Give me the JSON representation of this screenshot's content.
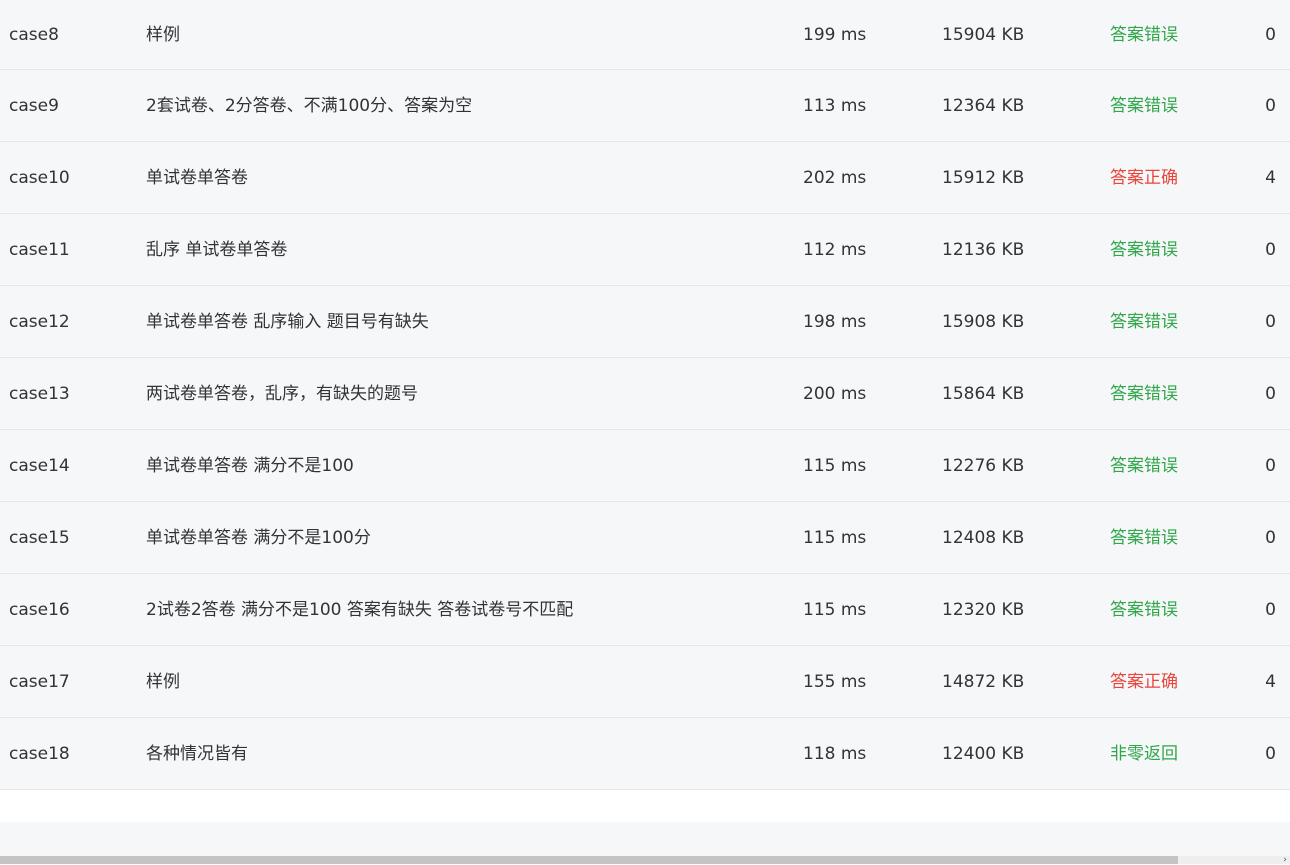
{
  "rows": [
    {
      "name": "case8",
      "desc": "样例",
      "time": "199 ms",
      "memory": "15904 KB",
      "status": "答案错误",
      "status_kind": "wrong",
      "score": "0"
    },
    {
      "name": "case9",
      "desc": "2套试卷、2分答卷、不满100分、答案为空",
      "time": "113 ms",
      "memory": "12364 KB",
      "status": "答案错误",
      "status_kind": "wrong",
      "score": "0"
    },
    {
      "name": "case10",
      "desc": "单试卷单答卷",
      "time": "202 ms",
      "memory": "15912 KB",
      "status": "答案正确",
      "status_kind": "right",
      "score": "4"
    },
    {
      "name": "case11",
      "desc": "乱序 单试卷单答卷",
      "time": "112 ms",
      "memory": "12136 KB",
      "status": "答案错误",
      "status_kind": "wrong",
      "score": "0"
    },
    {
      "name": "case12",
      "desc": "单试卷单答卷 乱序输入 题目号有缺失",
      "time": "198 ms",
      "memory": "15908 KB",
      "status": "答案错误",
      "status_kind": "wrong",
      "score": "0"
    },
    {
      "name": "case13",
      "desc": "两试卷单答卷，乱序，有缺失的题号",
      "time": "200 ms",
      "memory": "15864 KB",
      "status": "答案错误",
      "status_kind": "wrong",
      "score": "0"
    },
    {
      "name": "case14",
      "desc": "单试卷单答卷 满分不是100",
      "time": "115 ms",
      "memory": "12276 KB",
      "status": "答案错误",
      "status_kind": "wrong",
      "score": "0"
    },
    {
      "name": "case15",
      "desc": "单试卷单答卷 满分不是100分",
      "time": "115 ms",
      "memory": "12408 KB",
      "status": "答案错误",
      "status_kind": "wrong",
      "score": "0"
    },
    {
      "name": "case16",
      "desc": "2试卷2答卷 满分不是100 答案有缺失 答卷试卷号不匹配",
      "time": "115 ms",
      "memory": "12320 KB",
      "status": "答案错误",
      "status_kind": "wrong",
      "score": "0"
    },
    {
      "name": "case17",
      "desc": "样例",
      "time": "155 ms",
      "memory": "14872 KB",
      "status": "答案正确",
      "status_kind": "right",
      "score": "4"
    },
    {
      "name": "case18",
      "desc": "各种情况皆有",
      "time": "118 ms",
      "memory": "12400 KB",
      "status": "非零返回",
      "status_kind": "nonzero",
      "score": "0"
    }
  ],
  "colors": {
    "status_wrong": "#30a64a",
    "status_right": "#e8453c",
    "status_nonzero": "#30a64a",
    "row_bg": "#f6f7f9",
    "row_border": "#e4e6ea"
  },
  "scrollbar": {
    "arrow_icon": "chevron-right-icon"
  }
}
